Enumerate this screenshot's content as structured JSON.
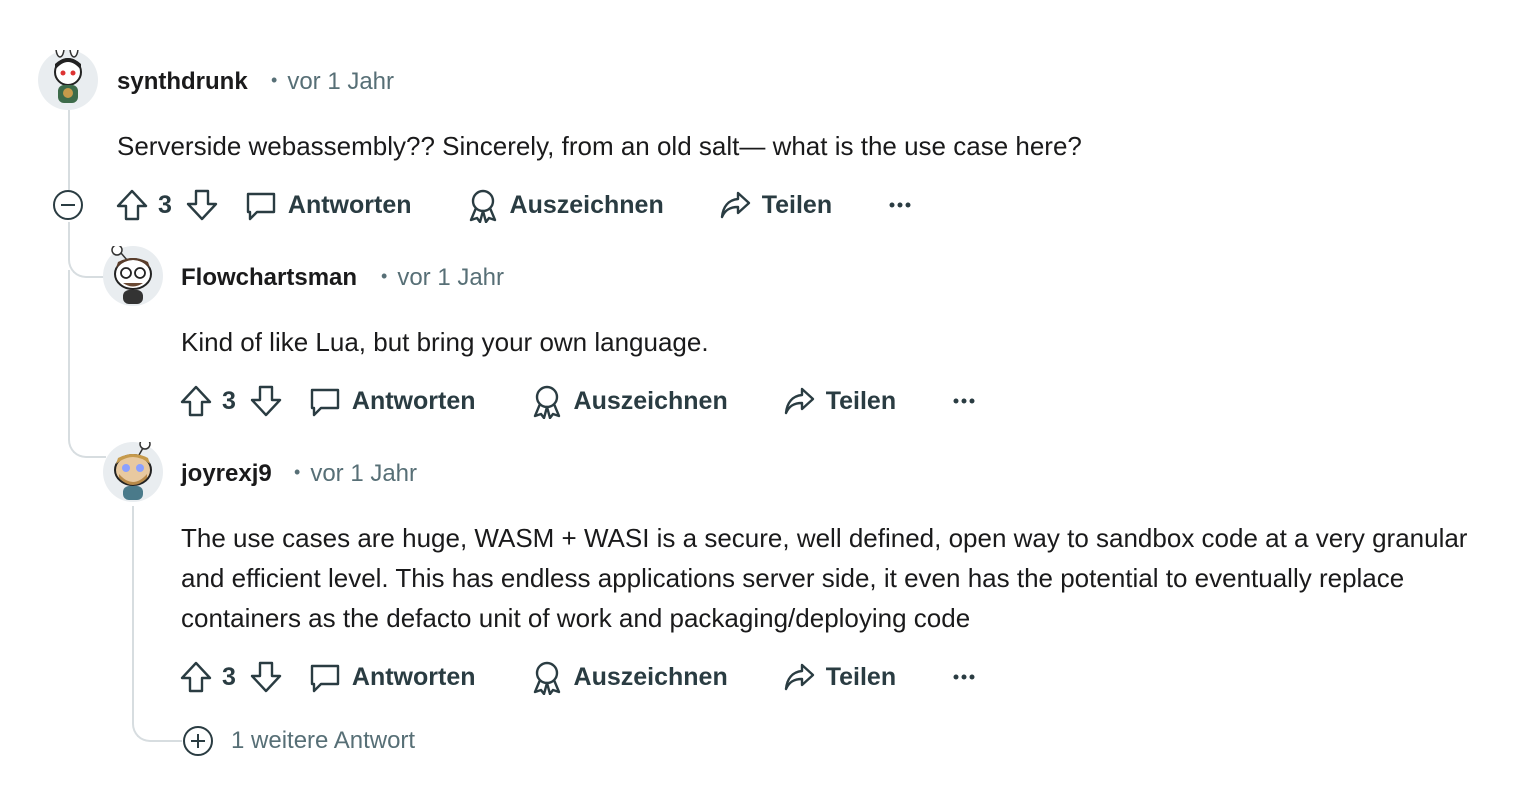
{
  "comments": [
    {
      "username": "synthdrunk",
      "time": "vor 1 Jahr",
      "text": "Serverside webassembly?? Sincerely, from an old salt— what is the use case here?",
      "votes": "3"
    },
    {
      "username": "Flowchartsman",
      "time": "vor 1 Jahr",
      "text": "Kind of like Lua, but bring your own language.",
      "votes": "3"
    },
    {
      "username": "joyrexj9",
      "time": "vor 1 Jahr",
      "text": "The use cases are huge, WASM + WASI is a secure, well defined, open way to sandbox code at a very granular and efficient level. This has endless applications server side, it even has the potential to eventually replace containers as the defacto unit of work and packaging/deploying code",
      "votes": "3"
    }
  ],
  "actions": {
    "reply": "Antworten",
    "award": "Auszeichnen",
    "share": "Teilen",
    "meta_separator": "•"
  },
  "more_replies": "1 weitere Antwort",
  "icons": [
    "upvote-icon",
    "downvote-icon",
    "comment-icon",
    "award-icon",
    "share-icon",
    "more-icon",
    "collapse-icon",
    "expand-icon",
    "avatar"
  ],
  "colors": {
    "text": "#1a1a1b",
    "meta": "#576f76",
    "thread_line": "#d7dde0",
    "icon": "#2a3c42"
  }
}
